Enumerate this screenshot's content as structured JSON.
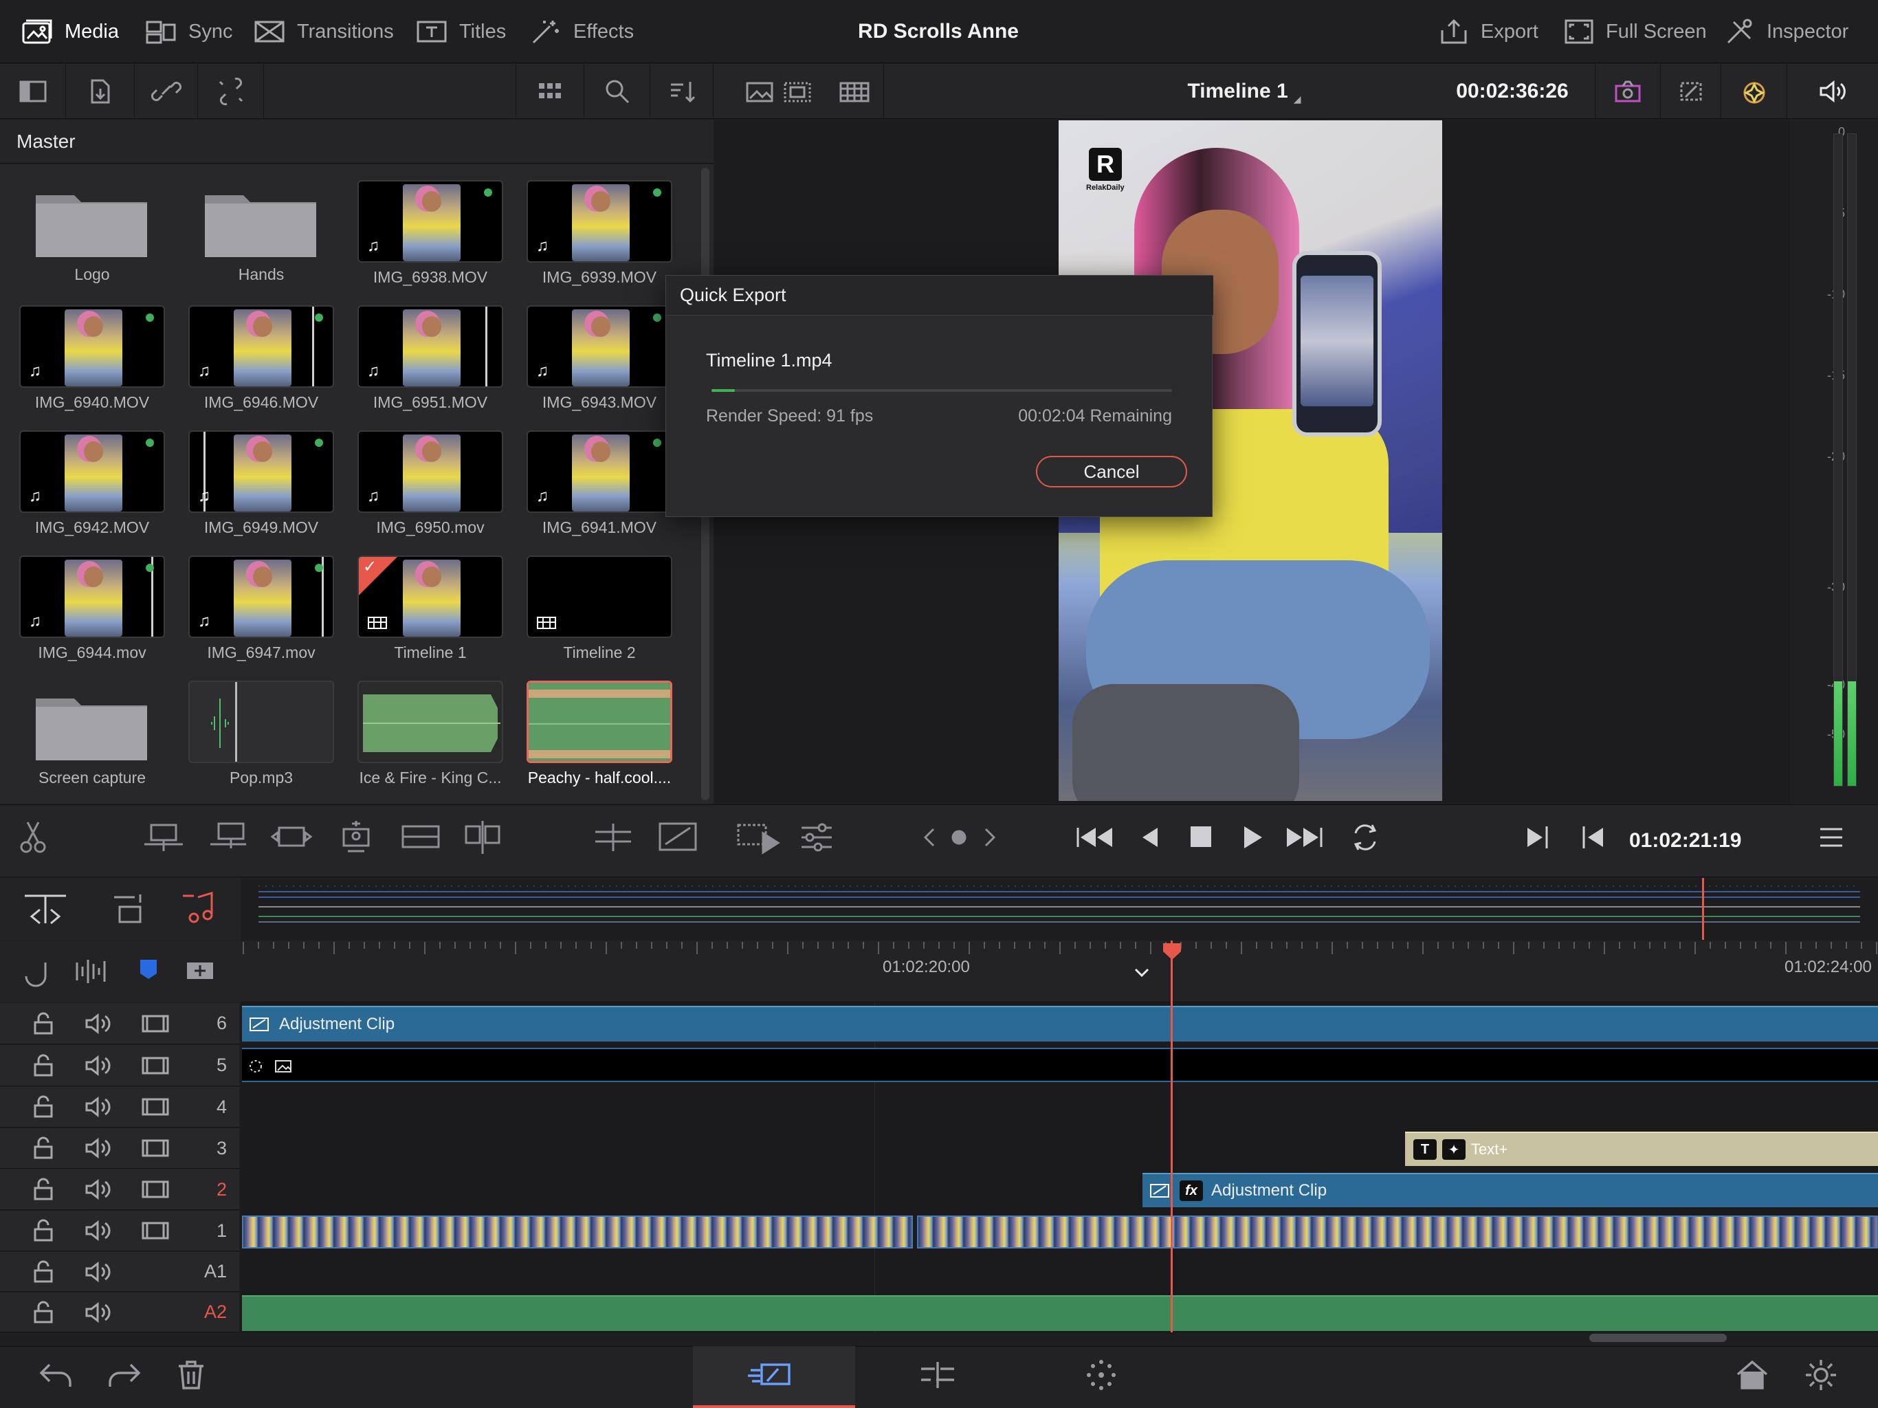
{
  "topbar": {
    "items": [
      {
        "label": "Media",
        "icon": "media-icon",
        "active": true
      },
      {
        "label": "Sync",
        "icon": "sync-icon"
      },
      {
        "label": "Transitions",
        "icon": "transitions-icon"
      },
      {
        "label": "Titles",
        "icon": "titles-icon"
      },
      {
        "label": "Effects",
        "icon": "effects-icon"
      }
    ],
    "project_title": "RD Scrolls Anne",
    "right_items": [
      {
        "label": "Export",
        "icon": "export-icon"
      },
      {
        "label": "Full Screen",
        "icon": "fullscreen-icon"
      },
      {
        "label": "Inspector",
        "icon": "inspector-icon"
      }
    ]
  },
  "viewer": {
    "timeline_name": "Timeline 1",
    "timecode": "00:02:36:26",
    "transport_timecode": "01:02:21:19",
    "watermark_logo": "R",
    "watermark_brand": "RelakDaily"
  },
  "media_pool": {
    "bin": "Master",
    "items": [
      {
        "name": "Logo",
        "kind": "folder"
      },
      {
        "name": "Hands",
        "kind": "folder"
      },
      {
        "name": "IMG_6938.MOV",
        "kind": "video"
      },
      {
        "name": "IMG_6939.MOV",
        "kind": "video"
      },
      {
        "name": "IMG_6940.MOV",
        "kind": "video"
      },
      {
        "name": "IMG_6946.MOV",
        "kind": "video"
      },
      {
        "name": "IMG_6951.MOV",
        "kind": "video"
      },
      {
        "name": "IMG_6943.MOV",
        "kind": "video"
      },
      {
        "name": "IMG_6942.MOV",
        "kind": "video"
      },
      {
        "name": "IMG_6949.MOV",
        "kind": "video"
      },
      {
        "name": "IMG_6950.mov",
        "kind": "video"
      },
      {
        "name": "IMG_6941.MOV",
        "kind": "video"
      },
      {
        "name": "IMG_6944.mov",
        "kind": "video"
      },
      {
        "name": "IMG_6947.mov",
        "kind": "video"
      },
      {
        "name": "Timeline 1",
        "kind": "timeline"
      },
      {
        "name": "Timeline 2",
        "kind": "timeline"
      },
      {
        "name": "Screen capture",
        "kind": "folder"
      },
      {
        "name": "Pop.mp3",
        "kind": "audio"
      },
      {
        "name": "Ice & Fire - King C...",
        "kind": "audio"
      },
      {
        "name": "Peachy - half.cool....",
        "kind": "audio",
        "selected": true
      }
    ]
  },
  "quick_export": {
    "title": "Quick Export",
    "filename": "Timeline 1.mp4",
    "progress": 0.05,
    "render_speed": "Render Speed: 91 fps",
    "remaining": "00:02:04 Remaining",
    "cancel_label": "Cancel"
  },
  "audio_meter": {
    "scale": [
      "0",
      "-5",
      "-10",
      "-15",
      "-20",
      "-30",
      "-40",
      "-50"
    ],
    "levels": [
      0.16,
      0.16
    ]
  },
  "timeline": {
    "ruler_labels": [
      "01:02:20:00",
      "01:02:24:00"
    ],
    "tracks": [
      "6",
      "5",
      "4",
      "3",
      "2",
      "1",
      "A1",
      "A2"
    ],
    "clips": {
      "adjustment_top": "Adjustment Clip",
      "adjustment_v2": "Adjustment Clip",
      "text_plus": "Text+",
      "fx_badge": "fx",
      "title_badge": "T"
    }
  },
  "colors": {
    "accent": "#e5584a",
    "progress": "#3fb35a",
    "adjustment_clip": "#2c6a96",
    "audio_clip": "#3d8a58",
    "text_clip": "#c9c2a0"
  }
}
